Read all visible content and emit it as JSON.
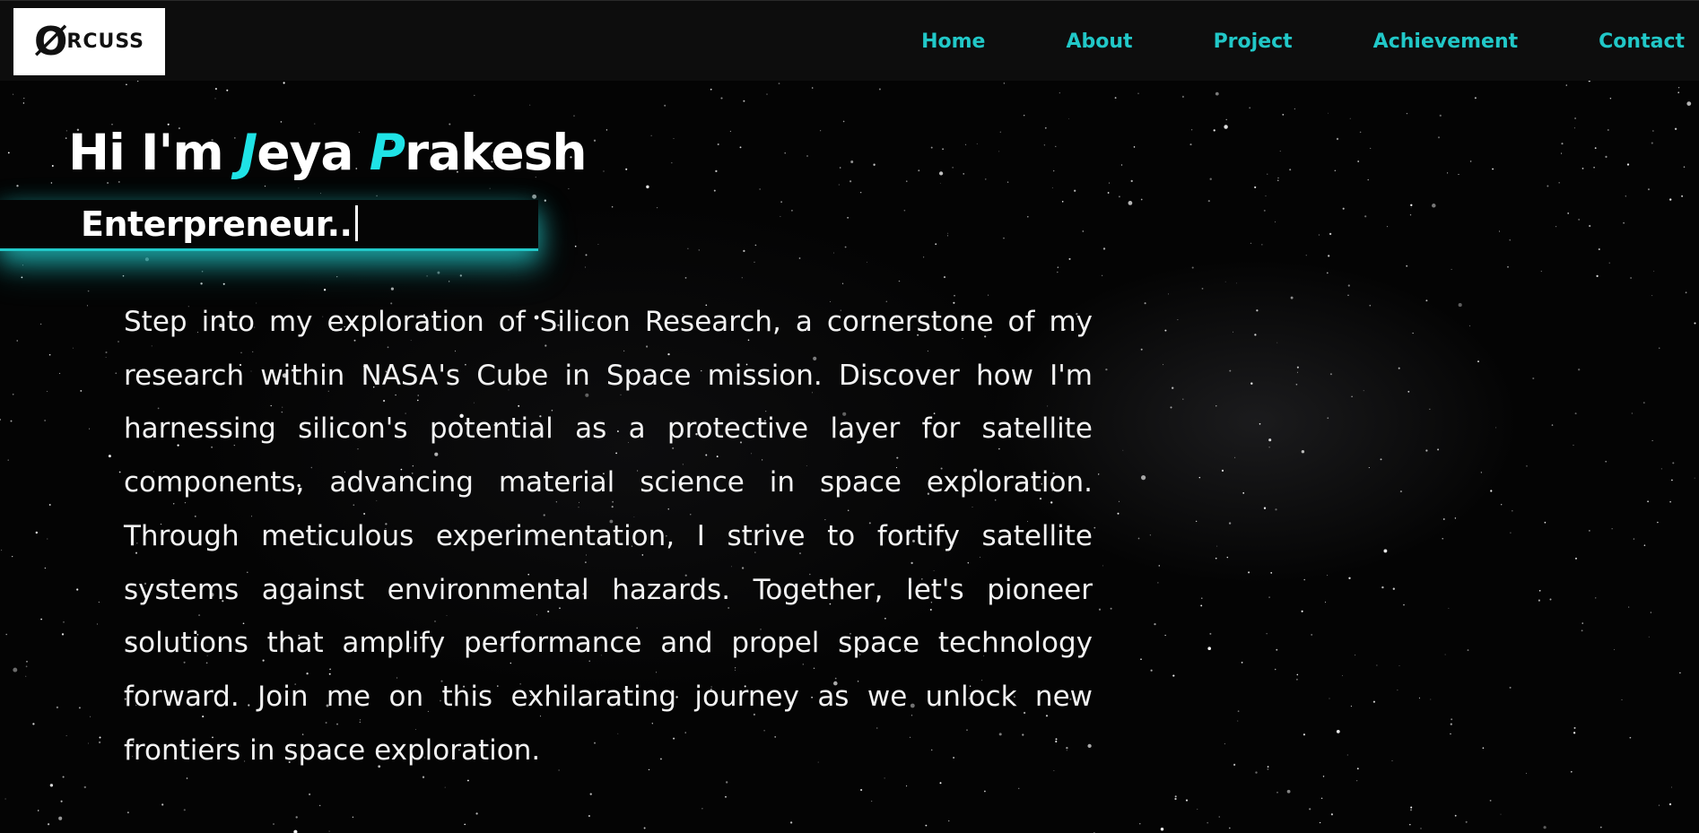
{
  "logo": {
    "mark": "Ø",
    "text": "RCUSS"
  },
  "nav": {
    "items": [
      "Home",
      "About",
      "Project",
      "Achievement",
      "Contact"
    ]
  },
  "hero": {
    "greeting": "Hi I'm ",
    "first_initial": "J",
    "first_rest": "eya ",
    "last_initial": "P",
    "last_rest": "rakesh",
    "role": "Enterpreneur..",
    "description": "Step into my exploration of Silicon Research, a cornerstone of my research within NASA's Cube in Space mission. Discover how I'm harnessing silicon's potential as a protective layer for satellite components, advancing material science in space exploration. Through meticulous experimentation, I strive to fortify satellite systems against environmental hazards. Together, let's pioneer solutions that amplify performance and propel space technology forward. Join me on this exhilarating journey as we unlock new frontiers in space exploration."
  },
  "colors": {
    "accent": "#21c8c8",
    "accent_bright": "#1fe3e6",
    "background": "#040404",
    "navbar": "#0d0d0d"
  }
}
